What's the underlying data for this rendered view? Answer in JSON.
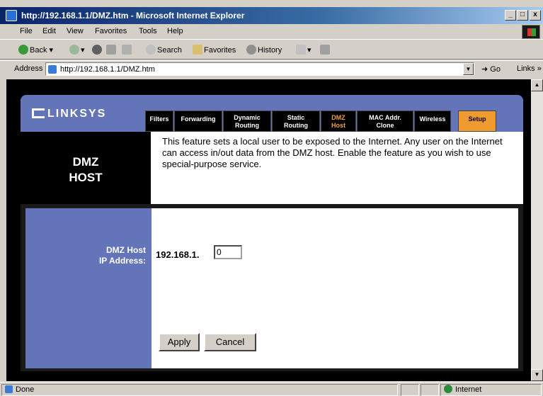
{
  "window": {
    "title": "http://192.168.1.1/DMZ.htm - Microsoft Internet Explorer",
    "minimize": "_",
    "maximize": "□",
    "close": "x"
  },
  "menu": {
    "file": "File",
    "edit": "Edit",
    "view": "View",
    "favorites": "Favorites",
    "tools": "Tools",
    "help": "Help"
  },
  "toolbar": {
    "back": "Back",
    "search": "Search",
    "favorites": "Favorites",
    "history": "History"
  },
  "address": {
    "label": "Address",
    "url": "http://192.168.1.1/DMZ.htm",
    "go": "Go",
    "links": "Links"
  },
  "page": {
    "logo": "LINKSYS",
    "tabs": [
      {
        "label": "Filters"
      },
      {
        "label": "Forwarding"
      },
      {
        "line1": "Dynamic",
        "line2": "Routing"
      },
      {
        "line1": "Static",
        "line2": "Routing"
      },
      {
        "line1": "DMZ",
        "line2": "Host"
      },
      {
        "line1": "MAC Addr.",
        "line2": "Clone"
      },
      {
        "label": "Wireless"
      },
      {
        "label": "Setup"
      }
    ],
    "section_title_1": "DMZ",
    "section_title_2": "HOST",
    "description": "This feature sets a local user to be exposed to the Internet. Any user on the Internet can access in/out data from the DMZ host. Enable the feature as you wish to use special-purpose service.",
    "field_label_1": "DMZ Host",
    "field_label_2": "IP Address:",
    "ip_prefix": "192.168.1.",
    "ip_value": "0",
    "apply": "Apply",
    "cancel": "Cancel"
  },
  "status": {
    "text": "Done",
    "zone": "Internet"
  },
  "colors": {
    "banner": "#6474b8",
    "setup_tab": "#f09a30",
    "active_tab_text": "#f0a040"
  }
}
